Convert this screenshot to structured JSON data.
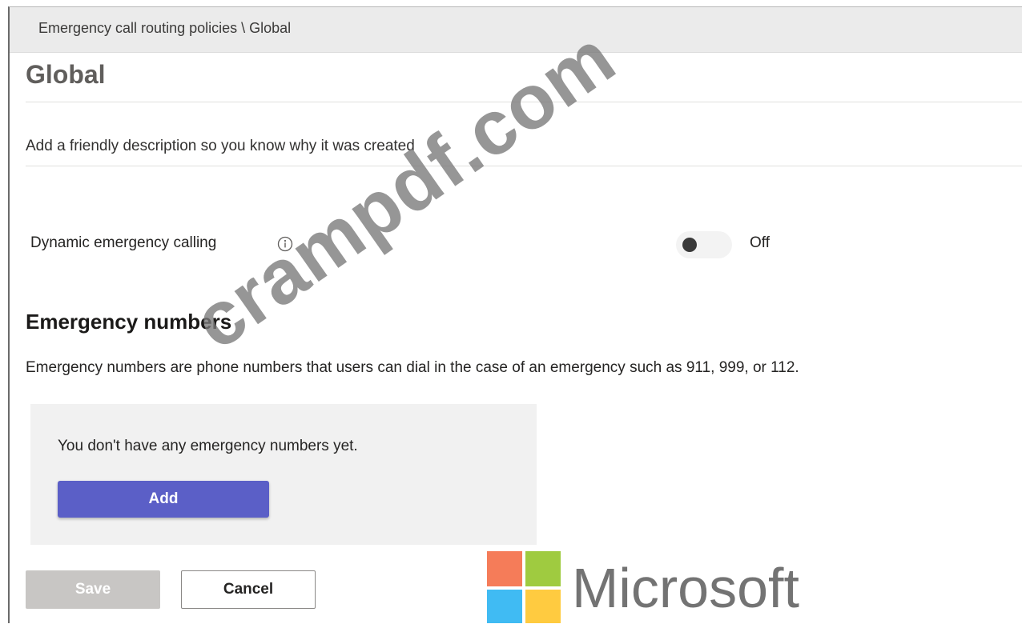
{
  "breadcrumb": "Emergency call routing policies \\ Global",
  "page_title": "Global",
  "description": {
    "placeholder": "Add a friendly description so you know why it was created",
    "value": ""
  },
  "dynamic_calling": {
    "label": "Dynamic emergency calling",
    "icon": "info-icon",
    "state": "Off"
  },
  "emergency_numbers": {
    "title": "Emergency numbers",
    "description": "Emergency numbers are phone numbers that users can dial in the case of an emergency such as 911, 999, or 112.",
    "empty_text": "You don't have any emergency numbers yet.",
    "add_label": "Add"
  },
  "footer": {
    "save_label": "Save",
    "cancel_label": "Cancel"
  },
  "watermark": "crampdf.com",
  "brand": {
    "wordmark": "Microsoft"
  },
  "colors": {
    "accent": "#5b5fc7",
    "disabled_button": "#c8c6c4",
    "panel": "#f1f1f1",
    "header_bar": "#ebebeb"
  }
}
